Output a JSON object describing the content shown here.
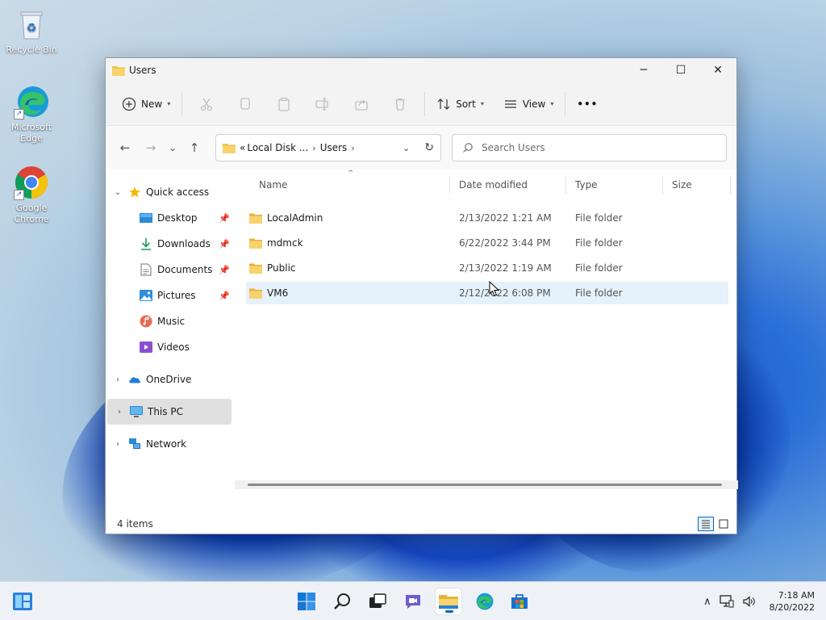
{
  "desktop": {
    "icons": [
      {
        "label": "Recycle Bin"
      },
      {
        "label": "Microsoft Edge"
      },
      {
        "label": "Google Chrome"
      }
    ]
  },
  "window": {
    "title": "Users",
    "controls": {
      "minimize": "─",
      "maximize": "☐",
      "close": "✕"
    }
  },
  "commandbar": {
    "new_label": "New",
    "sort_label": "Sort",
    "view_label": "View",
    "more_label": "•••"
  },
  "navigation": {
    "back": "←",
    "forward": "→",
    "recent": "⌄",
    "up": "↑",
    "breadcrumb": [
      "«",
      "Local Disk ...",
      "Users"
    ],
    "search_placeholder": "Search Users"
  },
  "sidebar": {
    "quick_access": "Quick access",
    "items": [
      {
        "label": "Desktop",
        "pinned": true
      },
      {
        "label": "Downloads",
        "pinned": true
      },
      {
        "label": "Documents",
        "pinned": true
      },
      {
        "label": "Pictures",
        "pinned": true
      },
      {
        "label": "Music",
        "pinned": false
      },
      {
        "label": "Videos",
        "pinned": false
      }
    ],
    "onedrive": "OneDrive",
    "this_pc": "This PC",
    "network": "Network"
  },
  "files": {
    "columns": [
      "Name",
      "Date modified",
      "Type",
      "Size"
    ],
    "rows": [
      {
        "name": "LocalAdmin",
        "date": "2/13/2022 1:21 AM",
        "type": "File folder"
      },
      {
        "name": "mdmck",
        "date": "6/22/2022 3:44 PM",
        "type": "File folder"
      },
      {
        "name": "Public",
        "date": "2/13/2022 1:19 AM",
        "type": "File folder"
      },
      {
        "name": "VM6",
        "date": "2/12/2022 6:08 PM",
        "type": "File folder"
      }
    ]
  },
  "status": {
    "item_count": "4 items"
  },
  "taskbar": {
    "time": "7:18 AM",
    "date": "8/20/2022"
  },
  "colors": {
    "accent": "#0067c0",
    "folder": "#f2c24b",
    "selected_row": "#e5f1fb"
  }
}
